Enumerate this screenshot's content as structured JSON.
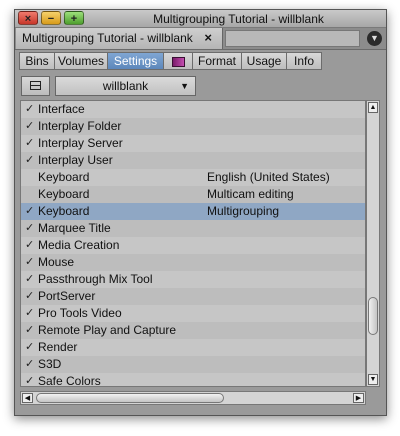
{
  "window": {
    "title": "Multigrouping Tutorial - willblank",
    "buttons": {
      "close": "×",
      "minimize": "−",
      "zoom": "+"
    }
  },
  "doc_tab": {
    "label": "Multigrouping Tutorial - willblank",
    "close": "×",
    "menu_icon": "chevron-down-circle-icon"
  },
  "subtabs": [
    {
      "label": "Bins"
    },
    {
      "label": "Volumes"
    },
    {
      "label": "Settings",
      "active": true
    },
    {
      "label": "",
      "icon": "project-media-icon"
    },
    {
      "label": "Format"
    },
    {
      "label": "Usage"
    },
    {
      "label": "Info"
    }
  ],
  "toolbar": {
    "view_icon": "list-view-icon",
    "user": "willblank",
    "user_arrow": "▼"
  },
  "settings": [
    {
      "check": "✓",
      "name": "Interface",
      "value": ""
    },
    {
      "check": "✓",
      "name": "Interplay Folder",
      "value": ""
    },
    {
      "check": "✓",
      "name": "Interplay Server",
      "value": ""
    },
    {
      "check": "✓",
      "name": "Interplay User",
      "value": ""
    },
    {
      "check": "",
      "name": "Keyboard",
      "value": "English (United States)"
    },
    {
      "check": "",
      "name": "Keyboard",
      "value": "Multicam editing"
    },
    {
      "check": "✓",
      "name": "Keyboard",
      "value": "Multigrouping",
      "selected": true
    },
    {
      "check": "✓",
      "name": "Marquee Title",
      "value": ""
    },
    {
      "check": "✓",
      "name": "Media Creation",
      "value": ""
    },
    {
      "check": "✓",
      "name": "Mouse",
      "value": ""
    },
    {
      "check": "✓",
      "name": "Passthrough Mix Tool",
      "value": ""
    },
    {
      "check": "✓",
      "name": "PortServer",
      "value": ""
    },
    {
      "check": "✓",
      "name": "Pro Tools Video",
      "value": ""
    },
    {
      "check": "✓",
      "name": "Remote Play and Capture",
      "value": ""
    },
    {
      "check": "✓",
      "name": "Render",
      "value": ""
    },
    {
      "check": "✓",
      "name": "S3D",
      "value": ""
    },
    {
      "check": "✓",
      "name": "Safe Colors",
      "value": ""
    }
  ],
  "scroll": {
    "up": "▲",
    "down": "▼",
    "left": "◀",
    "right": "▶"
  }
}
